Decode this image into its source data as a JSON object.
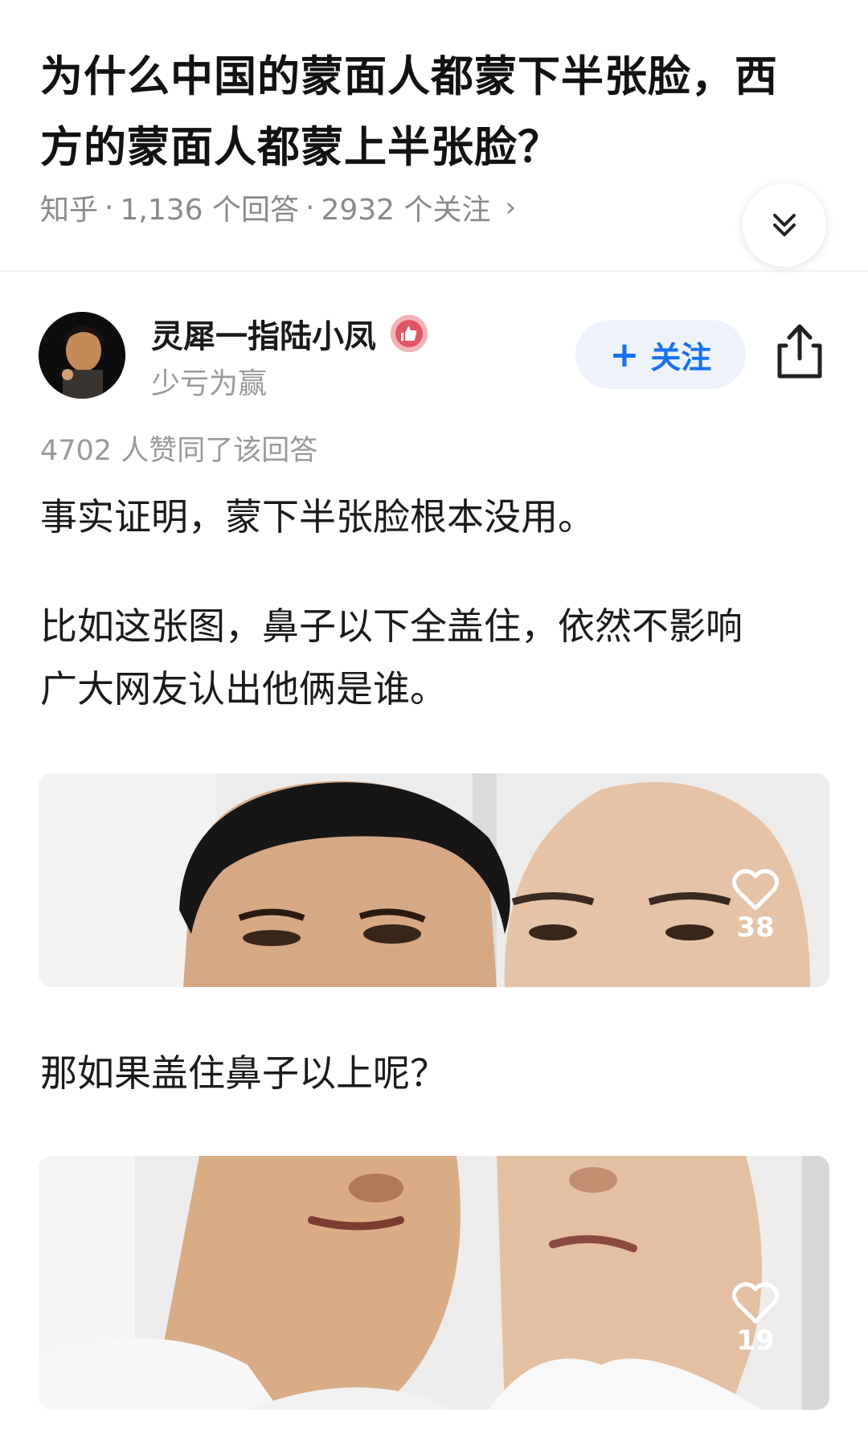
{
  "question": {
    "title_line1": "为什么中国的蒙面人都蒙下半张脸，西",
    "title_line2": "方的蒙面人都蒙上半张脸？",
    "source": "知乎",
    "answers": "1,136 个回答",
    "followers": "2932 个关注",
    "meta_chevron": "›",
    "collapse_icon": "double-chevron-down-icon"
  },
  "author": {
    "name": "灵犀一指陆小凤",
    "bio": "少亏为赢",
    "follow_label": "关注",
    "follow_plus": "+",
    "badge_icon": "thumbs-up-badge-icon",
    "share_icon": "share-icon"
  },
  "answer": {
    "votes": "4702 人赞同了该回答",
    "paragraph1": "事实证明，蒙下半张脸根本没用。",
    "paragraph2_line1": "比如这张图，鼻子以下全盖住，依然不影响",
    "paragraph2_line2": "广大网友认出他俩是谁。",
    "paragraph3": "那如果盖住鼻子以上呢？",
    "image1_likes": "38",
    "image2_likes": "19"
  },
  "colors": {
    "accent": "#1772f6",
    "follow_bg": "#eef3fb",
    "meta_text": "#8a8a8a",
    "badge": "#e25563"
  }
}
